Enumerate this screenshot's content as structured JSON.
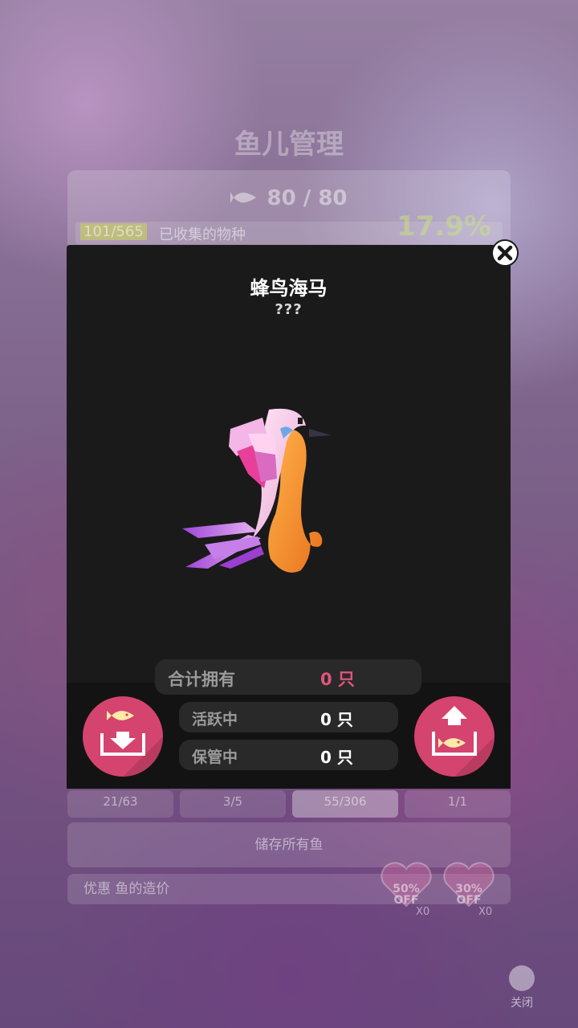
{
  "background": {
    "title": "鱼儿管理",
    "fish_count": "80 / 80",
    "collected_fraction": "101/565",
    "collected_label": "已收集的物种",
    "collected_percent": "17.9%",
    "tabs": [
      "21/63",
      "3/5",
      "55/306",
      "1/1"
    ],
    "store_all_label": "储存所有鱼",
    "discount_label": "优惠 鱼的造价",
    "discounts": [
      {
        "percent": "50%",
        "off": "OFF",
        "count": "X0"
      },
      {
        "percent": "30%",
        "off": "OFF",
        "count": "X0"
      }
    ],
    "close_label": "关闭"
  },
  "modal": {
    "name": "蜂鸟海马",
    "subtitle": "???",
    "stats": {
      "total_label": "合计拥有",
      "total_value": "0 只",
      "active_label": "活跃中",
      "active_value": "0 只",
      "stored_label": "保管中",
      "stored_value": "0 只"
    }
  },
  "colors": {
    "accent_pink": "#d4446e",
    "total_value_color": "#e0557c",
    "modal_bg": "#1b1a1b"
  },
  "icons": {
    "store_button": "fish-into-box-icon",
    "release_button": "fish-out-of-box-icon",
    "close": "close-x-icon"
  }
}
